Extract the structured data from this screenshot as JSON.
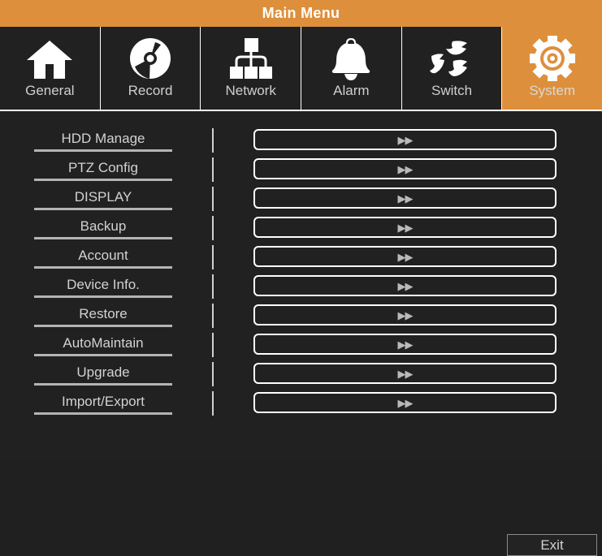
{
  "window": {
    "title": "Main Menu",
    "title_bar_color": "#de8f3c",
    "background_color": "#212121"
  },
  "nav": {
    "active_index": 5,
    "items": [
      {
        "label": "General",
        "icon": "home-icon"
      },
      {
        "label": "Record",
        "icon": "disc-icon"
      },
      {
        "label": "Network",
        "icon": "sitemap-icon"
      },
      {
        "label": "Alarm",
        "icon": "bell-icon"
      },
      {
        "label": "Switch",
        "icon": "birds-icon"
      },
      {
        "label": "System",
        "icon": "gear-icon"
      }
    ]
  },
  "menu": {
    "arrow_glyph": "▶▶",
    "rows": [
      {
        "label": "HDD Manage"
      },
      {
        "label": "PTZ Config"
      },
      {
        "label": "DISPLAY"
      },
      {
        "label": "Backup"
      },
      {
        "label": "Account"
      },
      {
        "label": "Device Info."
      },
      {
        "label": "Restore"
      },
      {
        "label": "AutoMaintain"
      },
      {
        "label": "Upgrade"
      },
      {
        "label": "Import/Export"
      }
    ]
  },
  "footer": {
    "exit_label": "Exit"
  }
}
